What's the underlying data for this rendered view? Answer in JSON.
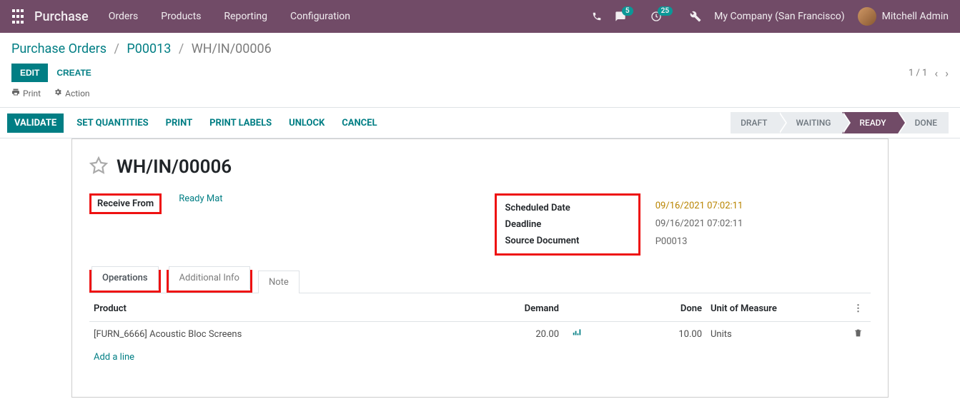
{
  "topnav": {
    "brand": "Purchase",
    "menu": [
      "Orders",
      "Products",
      "Reporting",
      "Configuration"
    ],
    "messages_badge": "5",
    "activities_badge": "25",
    "company": "My Company (San Francisco)",
    "user": "Mitchell Admin"
  },
  "breadcrumb": {
    "root": "Purchase Orders",
    "parent": "P00013",
    "current": "WH/IN/00006"
  },
  "cp": {
    "edit": "EDIT",
    "create": "CREATE",
    "print": "Print",
    "action": "Action",
    "pager": "1 / 1"
  },
  "actions": {
    "validate": "VALIDATE",
    "set_qty": "SET QUANTITIES",
    "print": "PRINT",
    "print_labels": "PRINT LABELS",
    "unlock": "UNLOCK",
    "cancel": "CANCEL"
  },
  "statusbar": [
    "DRAFT",
    "WAITING",
    "READY",
    "DONE"
  ],
  "statusbar_active_index": 2,
  "record": {
    "name": "WH/IN/00006",
    "receive_from_label": "Receive From",
    "receive_from_value": "Ready Mat",
    "scheduled_date_label": "Scheduled Date",
    "scheduled_date_value": "09/16/2021 07:02:11",
    "deadline_label": "Deadline",
    "deadline_value": "09/16/2021 07:02:11",
    "source_doc_label": "Source Document",
    "source_doc_value": "P00013"
  },
  "tabs": {
    "operations": "Operations",
    "additional": "Additional Info",
    "note": "Note"
  },
  "table": {
    "headers": {
      "product": "Product",
      "demand": "Demand",
      "done": "Done",
      "uom": "Unit of Measure"
    },
    "rows": [
      {
        "product": "[FURN_6666] Acoustic Bloc Screens",
        "demand": "20.00",
        "done": "10.00",
        "uom": "Units"
      }
    ],
    "add_line": "Add a line"
  }
}
